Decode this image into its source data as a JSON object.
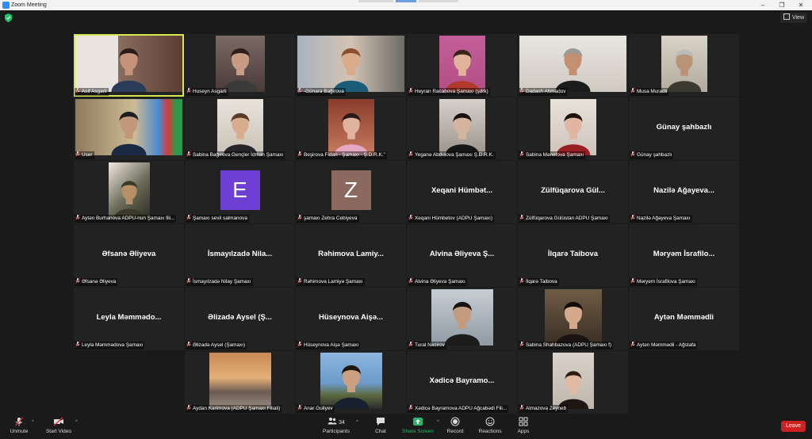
{
  "window": {
    "title": "Zoom Meeting"
  },
  "topbar": {
    "view_label": "View"
  },
  "participants": [
    {
      "label": "Asif Asgarli",
      "kind": "video",
      "photo": "slide",
      "active": true
    },
    {
      "label": "Huseyn Asgarli",
      "kind": "video",
      "photo": "curly-hair"
    },
    {
      "label": "-Günara Bağırova",
      "kind": "video",
      "photo": "woman-office"
    },
    {
      "label": "Heyran Racabova Şamaxı (şdrk)",
      "kind": "video",
      "photo": "girl-pink"
    },
    {
      "label": "Dadash Ahmadov",
      "kind": "video",
      "photo": "man-grey",
      "wide": true
    },
    {
      "label": "Musa Muradli",
      "kind": "video",
      "photo": "older-man"
    },
    {
      "label": "User",
      "kind": "video",
      "photo": "official-flag",
      "wide": true
    },
    {
      "label": "Sabina Bağırova Gençler İdman Şamaxı",
      "kind": "video",
      "photo": "woman-lightroom"
    },
    {
      "label": "Beşirova Fidan - Şamaxı - Ş.D.R.K.\"",
      "kind": "video",
      "photo": "woman-pink"
    },
    {
      "label": "Yeganə Abdulova Şamaxı Ş.D.R.K.",
      "kind": "video",
      "photo": "girl-dark"
    },
    {
      "label": "Sabina Mənefova Şamaxı",
      "kind": "video",
      "photo": "girl-red"
    },
    {
      "label": "Günay şahbazlı",
      "kind": "name",
      "big": "Günay şahbazlı"
    },
    {
      "label": "Aytən Burhanova ADPU-nun Şamaxı fili...",
      "kind": "video",
      "photo": "plant"
    },
    {
      "label": "Şamaxı sevil salmanova",
      "kind": "avatar",
      "letter": "E",
      "color": "#6e3fd3"
    },
    {
      "label": "şamaxı Zehra Cebiyeva",
      "kind": "avatar",
      "letter": "Z",
      "color": "#8a6a5e"
    },
    {
      "label": "Xeqani Hümbetov (ADPU Şamaxı)",
      "kind": "name",
      "big": "Xeqani Hümbət..."
    },
    {
      "label": "Zülfüqarova Gülüstan ADPU Şamaxı",
      "kind": "name",
      "big": "Zülfüqarova Gül..."
    },
    {
      "label": "Nazilə Ağayeva Şamaxı",
      "kind": "name",
      "big": "Nazilə Ağayeva..."
    },
    {
      "label": "Əfsanə Əliyeva",
      "kind": "name",
      "big": "Əfsanə Əliyeva"
    },
    {
      "label": "İsmayılzadə Nilay Şamaxı",
      "kind": "name",
      "big": "İsmayılzadə Nila..."
    },
    {
      "label": "Rəhimova Lamiyə Şamaxı",
      "kind": "name",
      "big": "Rəhimova Lamiy..."
    },
    {
      "label": "Alvina Əliyeva Şamaxı",
      "kind": "name",
      "big": "Alvina Əliyeva Ş..."
    },
    {
      "label": "İlqarə Taibova",
      "kind": "name",
      "big": "İlqarə Taibova"
    },
    {
      "label": "Məryem İsrafilova Şamaxı",
      "kind": "name",
      "big": "Məryəm İsrafilo..."
    },
    {
      "label": "Leyla Məmmədova Şamaxı",
      "kind": "name",
      "big": "Leyla Məmmədo..."
    },
    {
      "label": "Əlizadə Aysel (Şamaxı)",
      "kind": "name",
      "big": "Əlizadə Aysel (Ş..."
    },
    {
      "label": "Hüseynova Aişə Şamaxı",
      "kind": "name",
      "big": "Hüseynova Aişə..."
    },
    {
      "label": "Tural Nəsirov",
      "kind": "video",
      "photo": "man-beard"
    },
    {
      "label": "Sabina Shahbazova (ADPU Şamaxı f)",
      "kind": "video",
      "photo": "woman-lamp"
    },
    {
      "label": "Aytən Məmmədli - Ağstafa",
      "kind": "name",
      "big": "Aytən Məmmədli"
    },
    {
      "label": "",
      "kind": "empty"
    },
    {
      "label": "Aydan Karimova (ADPU Şamaxı Filiali)",
      "kind": "video",
      "photo": "sunset"
    },
    {
      "label": "Anar Guliyev",
      "kind": "video",
      "photo": "man-sea"
    },
    {
      "label": "Xədicə Bayramova ADPU Ağcabədi Fili...",
      "kind": "name",
      "big": "Xədicə Bayramo..."
    },
    {
      "label": "Almazova Zeyneb",
      "kind": "video",
      "photo": "woman-hair"
    },
    {
      "label": "",
      "kind": "empty"
    }
  ],
  "toolbar": {
    "unmute": "Unmute",
    "start_video": "Start Video",
    "participants": "Participants",
    "participants_count": "34",
    "chat": "Chat",
    "share_screen": "Share Screen",
    "record": "Record",
    "reactions": "Reactions",
    "apps": "Apps",
    "leave": "Leave"
  },
  "colors": {
    "accent_active": "#d7e84e",
    "share_green": "#2fb36b",
    "leave_red": "#cc2222"
  }
}
